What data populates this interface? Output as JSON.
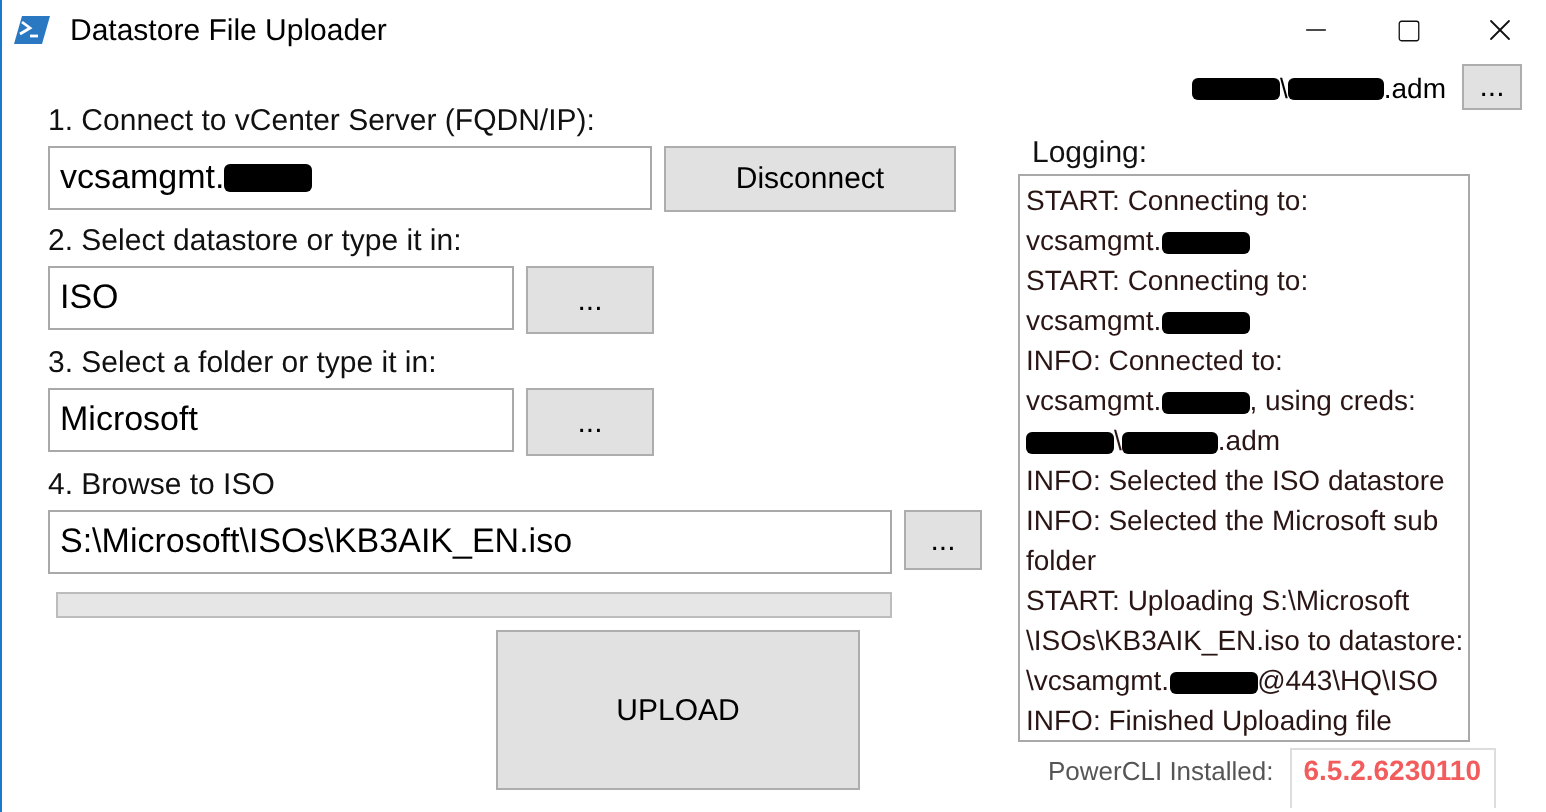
{
  "window": {
    "title": "Datastore File Uploader"
  },
  "user": {
    "parts": [
      {
        "kind": "redaction"
      },
      {
        "kind": "text",
        "text": "\\"
      },
      {
        "kind": "redaction"
      },
      {
        "kind": "text",
        "text": ".adm"
      }
    ],
    "button": "..."
  },
  "steps": [
    {
      "label": "1. Connect to vCenter Server (FQDN/IP):",
      "value": [
        {
          "kind": "text",
          "text": "vcsamgmt."
        },
        {
          "kind": "redaction"
        }
      ],
      "button": "Disconnect",
      "kind": "wide"
    },
    {
      "label": "2. Select datastore or type it in:",
      "value": [
        {
          "kind": "text",
          "text": "ISO"
        }
      ],
      "button": "...",
      "kind": "short"
    },
    {
      "label": "3. Select a folder or type it in:",
      "value": [
        {
          "kind": "text",
          "text": "Microsoft"
        }
      ],
      "button": "...",
      "kind": "short"
    },
    {
      "label": "4. Browse to ISO",
      "value": [
        {
          "kind": "text",
          "text": "S:\\Microsoft\\ISOs\\KB3AIK_EN.iso"
        }
      ],
      "button": "...",
      "kind": "long"
    }
  ],
  "progress": {
    "level": 0
  },
  "upload_button": "UPLOAD",
  "logging": {
    "label": "Logging:",
    "lines": [
      [
        {
          "kind": "text",
          "text": "START: Connecting to:"
        }
      ],
      [
        {
          "kind": "text",
          "text": "vcsamgmt."
        },
        {
          "kind": "redaction"
        }
      ],
      [
        {
          "kind": "text",
          "text": "START: Connecting to:"
        }
      ],
      [
        {
          "kind": "text",
          "text": "vcsamgmt."
        },
        {
          "kind": "redaction"
        }
      ],
      [
        {
          "kind": "text",
          "text": "INFO: Connected to:"
        }
      ],
      [
        {
          "kind": "text",
          "text": "vcsamgmt."
        },
        {
          "kind": "redaction"
        },
        {
          "kind": "text",
          "text": ", using creds:"
        }
      ],
      [
        {
          "kind": "redaction"
        },
        {
          "kind": "text",
          "text": "\\"
        },
        {
          "kind": "redaction"
        },
        {
          "kind": "text",
          "text": ".adm"
        }
      ],
      [
        {
          "kind": "text",
          "text": "INFO: Selected the ISO datastore"
        }
      ],
      [
        {
          "kind": "text",
          "text": "INFO: Selected the Microsoft sub"
        }
      ],
      [
        {
          "kind": "text",
          "text": "folder"
        }
      ],
      [
        {
          "kind": "text",
          "text": "START: Uploading S:\\Microsoft"
        }
      ],
      [
        {
          "kind": "text",
          "text": "\\ISOs\\KB3AIK_EN.iso to datastore:"
        }
      ],
      [
        {
          "kind": "text",
          "text": "\\vcsamgmt."
        },
        {
          "kind": "redaction"
        },
        {
          "kind": "text",
          "text": "@443\\HQ\\ISO"
        }
      ],
      [
        {
          "kind": "text",
          "text": "INFO: Finished Uploading file"
        }
      ]
    ]
  },
  "powercli": {
    "label": "PowerCLI Installed:",
    "version": "6.5.2.6230110"
  }
}
